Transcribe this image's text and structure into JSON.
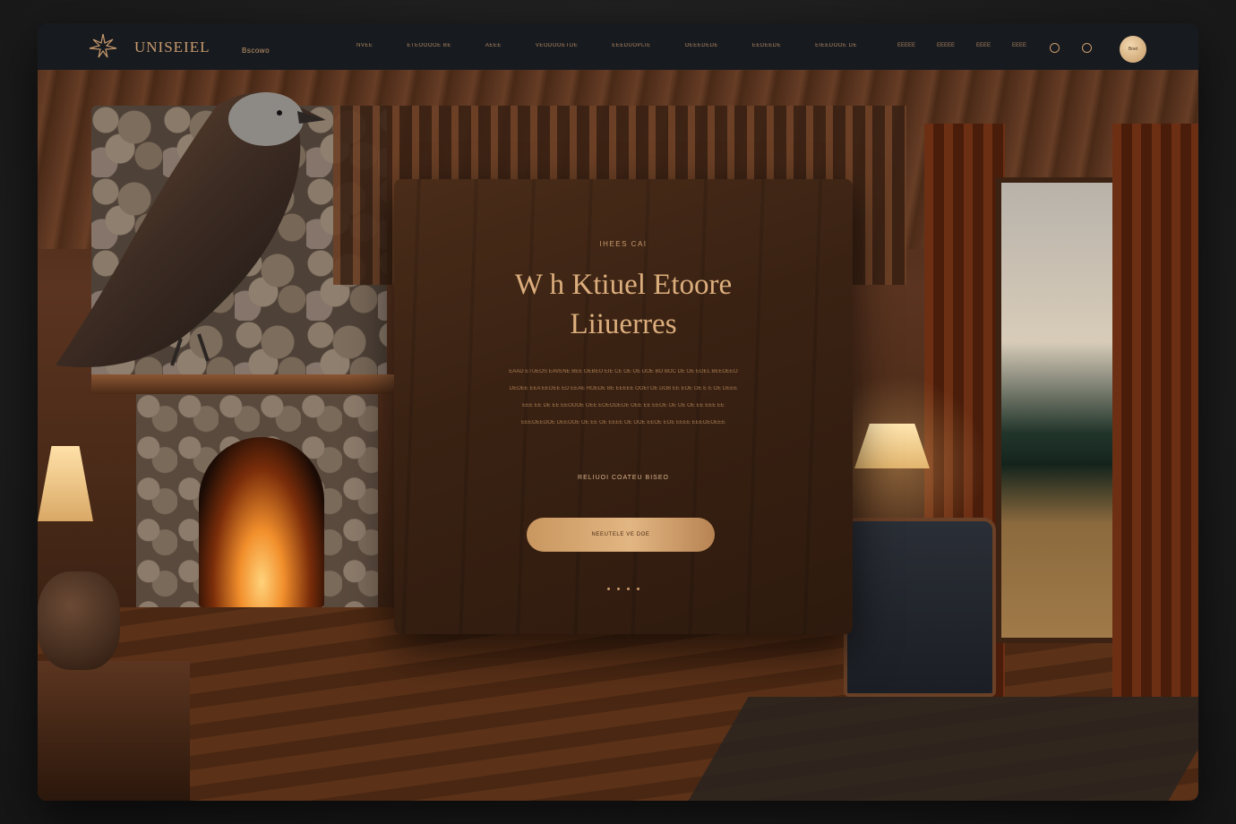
{
  "nav": {
    "brand": "UNISEIEL",
    "brand_sub": "Bscowo",
    "links": [
      "NVEE",
      "ETEOOOOE BE",
      "AEEE",
      "VEODOOETDE",
      "EEEDUOPLIE",
      "OEEEDEDE",
      "EEDEEDE",
      "EIEEDOOE DE"
    ],
    "right_links": [
      "EEEEE",
      "EEEEE",
      "EEEE",
      "EEEE"
    ],
    "cta_label": "Boet"
  },
  "hero": {
    "eyebrow": "IHEES CAI",
    "headline_line1": "W h Ktiuel Etoore",
    "headline_line2": "Liiuerres",
    "body_lines": [
      "EAAD ETUEOS EAVENE BEE OEBEO EIE CE OE OE DOE BO BOC DE OE EOEL BEEOEEO",
      "DEOEE EEA EEOEE ED EEAE ROEDE BE EEEEE OOEI OE DOB EE EOE OE E E OE DEEE",
      "EEE EE DE EE EEOOOE OEE EOEODEOE OEE EE EEOE OE OE OE EE EEE EE",
      "EEEOEEOOE DEEOOE OE EE OE EEEE OE OOE EEOE EOE EEEE EEEOEOEEE"
    ],
    "sublink": "RELIUOI COATEU BISEO",
    "cta_label": "NEEUTELE VE DOE",
    "dots_count": 4
  },
  "colors": {
    "accent": "#c99b6d",
    "nav_bg": "#171a1f",
    "cta_gold": "#e2b682"
  },
  "icons": {
    "logo": "bird-crest-icon",
    "nav_circle_1": "circle-icon",
    "nav_circle_2": "circle-icon"
  }
}
